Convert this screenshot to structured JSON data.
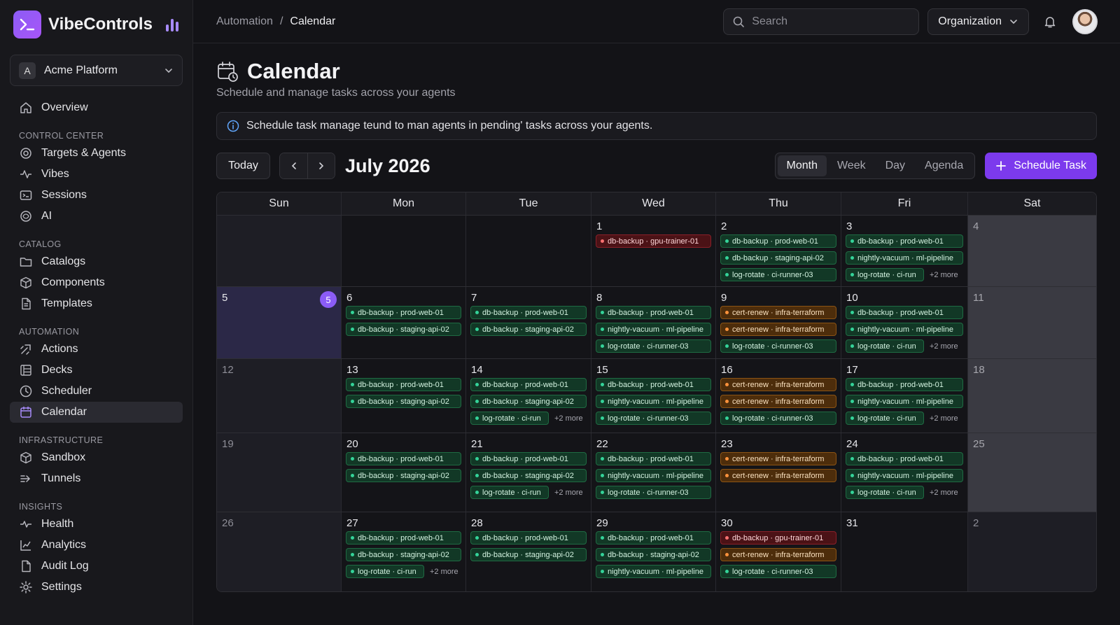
{
  "brand": {
    "name": "VibeControls"
  },
  "org": {
    "initial": "A",
    "name": "Acme Platform"
  },
  "sidebar": {
    "top": [
      {
        "label": "Overview",
        "icon": "home-icon"
      }
    ],
    "sections": [
      {
        "title": "CONTROL CENTER",
        "items": [
          {
            "label": "Targets & Agents",
            "icon": "target-icon"
          },
          {
            "label": "Vibes",
            "icon": "pulse-icon"
          },
          {
            "label": "Sessions",
            "icon": "terminal-icon"
          },
          {
            "label": "AI",
            "icon": "ai-icon"
          }
        ]
      },
      {
        "title": "CATALOG",
        "items": [
          {
            "label": "Catalogs",
            "icon": "folder-icon"
          },
          {
            "label": "Components",
            "icon": "cube-icon"
          },
          {
            "label": "Templates",
            "icon": "file-icon"
          }
        ]
      },
      {
        "title": "AUTOMATION",
        "items": [
          {
            "label": "Actions",
            "icon": "actions-icon"
          },
          {
            "label": "Decks",
            "icon": "decks-icon"
          },
          {
            "label": "Scheduler",
            "icon": "clock-icon"
          },
          {
            "label": "Calendar",
            "icon": "calendar-icon",
            "active": true
          }
        ]
      },
      {
        "title": "INFRASTRUCTURE",
        "items": [
          {
            "label": "Sandbox",
            "icon": "box-icon"
          },
          {
            "label": "Tunnels",
            "icon": "tunnel-icon"
          }
        ]
      },
      {
        "title": "INSIGHTS",
        "items": [
          {
            "label": "Health",
            "icon": "heartbeat-icon"
          },
          {
            "label": "Analytics",
            "icon": "chart-icon"
          },
          {
            "label": "Audit Log",
            "icon": "audit-icon"
          },
          {
            "label": "Settings",
            "icon": "gear-icon"
          }
        ]
      }
    ]
  },
  "topbar": {
    "breadcrumb": [
      "Automation",
      "Calendar"
    ],
    "search_placeholder": "Search",
    "org_button": "Organization"
  },
  "page": {
    "title": "Calendar",
    "subtitle": "Schedule and manage tasks across your agents",
    "banner": "Schedule task manage teund to man agents in pending' tasks across your agents."
  },
  "toolbar": {
    "today": "Today",
    "month_label": "July 2026",
    "views": [
      "Month",
      "Week",
      "Day",
      "Agenda"
    ],
    "active_view": "Month",
    "schedule_button": "Schedule Task"
  },
  "colors": {
    "accent": "#7c3aed",
    "today": "#8b5cf6",
    "green": "#34d399",
    "orange": "#fb923c",
    "red": "#f87171"
  },
  "calendar": {
    "weekdays": [
      "Sun",
      "Mon",
      "Tue",
      "Wed",
      "Thu",
      "Fri",
      "Sat"
    ],
    "weeks": [
      [
        {
          "day": "",
          "kind": "sun",
          "events": []
        },
        {
          "day": "",
          "events": []
        },
        {
          "day": "",
          "events": []
        },
        {
          "day": "1",
          "events": [
            {
              "t": "db-backup · gpu-trainer-01",
              "c": "red"
            }
          ]
        },
        {
          "day": "2",
          "events": [
            {
              "t": "db-backup · prod-web-01",
              "c": "green"
            },
            {
              "t": "db-backup · staging-api-02",
              "c": "green"
            },
            {
              "t": "log-rotate · ci-runner-03",
              "c": "green"
            }
          ]
        },
        {
          "day": "3",
          "events": [
            {
              "t": "db-backup · prod-web-01",
              "c": "green"
            },
            {
              "t": "nightly-vacuum · ml-pipeline",
              "c": "green"
            },
            {
              "t": "log-rotate · ci-run",
              "c": "green"
            }
          ],
          "more": "+2 more"
        },
        {
          "day": "4",
          "kind": "sat",
          "events": []
        }
      ],
      [
        {
          "day": "5",
          "kind": "today",
          "badge": "5",
          "events": []
        },
        {
          "day": "6",
          "events": [
            {
              "t": "db-backup · prod-web-01",
              "c": "green"
            },
            {
              "t": "db-backup · staging-api-02",
              "c": "green"
            }
          ]
        },
        {
          "day": "7",
          "events": [
            {
              "t": "db-backup · prod-web-01",
              "c": "green"
            },
            {
              "t": "db-backup · staging-api-02",
              "c": "green"
            }
          ]
        },
        {
          "day": "8",
          "events": [
            {
              "t": "db-backup · prod-web-01",
              "c": "green"
            },
            {
              "t": "nightly-vacuum · ml-pipeline",
              "c": "green"
            },
            {
              "t": "log-rotate · ci-runner-03",
              "c": "green"
            }
          ]
        },
        {
          "day": "9",
          "events": [
            {
              "t": "cert-renew · infra-terraform",
              "c": "orange"
            },
            {
              "t": "cert-renew · infra-terraform",
              "c": "orange"
            },
            {
              "t": "log-rotate · ci-runner-03",
              "c": "green"
            }
          ]
        },
        {
          "day": "10",
          "events": [
            {
              "t": "db-backup · prod-web-01",
              "c": "green"
            },
            {
              "t": "nightly-vacuum · ml-pipeline",
              "c": "green"
            },
            {
              "t": "log-rotate · ci-run",
              "c": "green"
            }
          ],
          "more": "+2 more"
        },
        {
          "day": "11",
          "kind": "sat",
          "events": []
        }
      ],
      [
        {
          "day": "12",
          "kind": "sun",
          "events": []
        },
        {
          "day": "13",
          "events": [
            {
              "t": "db-backup · prod-web-01",
              "c": "green"
            },
            {
              "t": "db-backup · staging-api-02",
              "c": "green"
            }
          ]
        },
        {
          "day": "14",
          "events": [
            {
              "t": "db-backup · prod-web-01",
              "c": "green"
            },
            {
              "t": "db-backup · staging-api-02",
              "c": "green"
            },
            {
              "t": "log-rotate · ci-run",
              "c": "green"
            }
          ],
          "more": "+2 more"
        },
        {
          "day": "15",
          "events": [
            {
              "t": "db-backup · prod-web-01",
              "c": "green"
            },
            {
              "t": "nightly-vacuum · ml-pipeline",
              "c": "green"
            },
            {
              "t": "log-rotate · ci-runner-03",
              "c": "green"
            }
          ]
        },
        {
          "day": "16",
          "events": [
            {
              "t": "cert-renew · infra-terraform",
              "c": "orange"
            },
            {
              "t": "cert-renew · infra-terraform",
              "c": "orange"
            },
            {
              "t": "log-rotate · ci-runner-03",
              "c": "green"
            }
          ]
        },
        {
          "day": "17",
          "events": [
            {
              "t": "db-backup · prod-web-01",
              "c": "green"
            },
            {
              "t": "nightly-vacuum · ml-pipeline",
              "c": "green"
            },
            {
              "t": "log-rotate · ci-run",
              "c": "green"
            }
          ],
          "more": "+2 more"
        },
        {
          "day": "18",
          "kind": "sat",
          "events": []
        }
      ],
      [
        {
          "day": "19",
          "kind": "sun",
          "events": []
        },
        {
          "day": "20",
          "events": [
            {
              "t": "db-backup · prod-web-01",
              "c": "green"
            },
            {
              "t": "db-backup · staging-api-02",
              "c": "green"
            }
          ]
        },
        {
          "day": "21",
          "events": [
            {
              "t": "db-backup · prod-web-01",
              "c": "green"
            },
            {
              "t": "db-backup · staging-api-02",
              "c": "green"
            },
            {
              "t": "log-rotate · ci-run",
              "c": "green"
            }
          ],
          "more": "+2 more"
        },
        {
          "day": "22",
          "events": [
            {
              "t": "db-backup · prod-web-01",
              "c": "green"
            },
            {
              "t": "nightly-vacuum · ml-pipeline",
              "c": "green"
            },
            {
              "t": "log-rotate · ci-runner-03",
              "c": "green"
            }
          ]
        },
        {
          "day": "23",
          "events": [
            {
              "t": "cert-renew · infra-terraform",
              "c": "orange"
            },
            {
              "t": "cert-renew · infra-terraform",
              "c": "orange"
            }
          ]
        },
        {
          "day": "24",
          "events": [
            {
              "t": "db-backup · prod-web-01",
              "c": "green"
            },
            {
              "t": "nightly-vacuum · ml-pipeline",
              "c": "green"
            },
            {
              "t": "log-rotate · ci-run",
              "c": "green"
            }
          ],
          "more": "+2 more"
        },
        {
          "day": "25",
          "kind": "sat",
          "events": []
        }
      ],
      [
        {
          "day": "26",
          "kind": "sun",
          "events": []
        },
        {
          "day": "27",
          "events": [
            {
              "t": "db-backup · prod-web-01",
              "c": "green"
            },
            {
              "t": "db-backup · staging-api-02",
              "c": "green"
            },
            {
              "t": "log-rotate · ci-run",
              "c": "green"
            }
          ],
          "more": "+2 more"
        },
        {
          "day": "28",
          "events": [
            {
              "t": "db-backup · prod-web-01",
              "c": "green"
            },
            {
              "t": "db-backup · staging-api-02",
              "c": "green"
            }
          ]
        },
        {
          "day": "29",
          "events": [
            {
              "t": "db-backup · prod-web-01",
              "c": "green"
            },
            {
              "t": "db-backup · staging-api-02",
              "c": "green"
            },
            {
              "t": "nightly-vacuum · ml-pipeline",
              "c": "green"
            }
          ]
        },
        {
          "day": "30",
          "events": [
            {
              "t": "db-backup · gpu-trainer-01",
              "c": "red"
            },
            {
              "t": "cert-renew · infra-terraform",
              "c": "orange"
            },
            {
              "t": "log-rotate · ci-runner-03",
              "c": "green"
            }
          ]
        },
        {
          "day": "31",
          "events": []
        },
        {
          "day": "2",
          "kind": "sun",
          "events": []
        }
      ]
    ]
  }
}
